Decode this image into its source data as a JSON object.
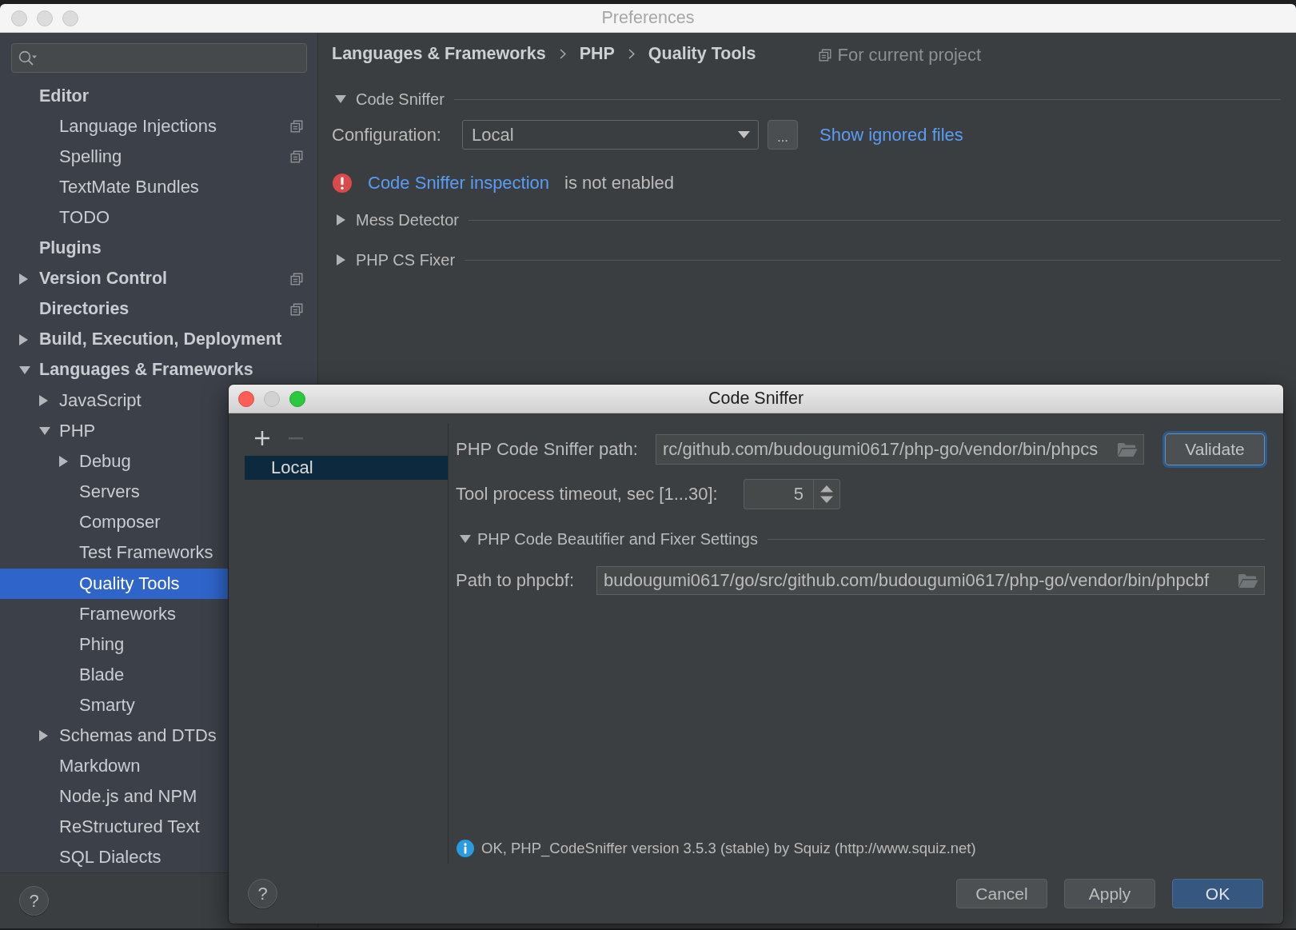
{
  "preferences_window": {
    "title": "Preferences",
    "active": false
  },
  "sidebar": {
    "items": [
      {
        "label": "Editor",
        "selected": false,
        "project_scope": false,
        "children": [
          {
            "label": "Language Injections",
            "selected": false,
            "project_scope": true
          },
          {
            "label": "Spelling",
            "selected": false,
            "project_scope": true
          },
          {
            "label": "TextMate Bundles",
            "selected": false,
            "project_scope": false
          },
          {
            "label": "TODO",
            "selected": false,
            "project_scope": false
          }
        ]
      },
      {
        "label": "Plugins",
        "selected": false,
        "project_scope": false
      },
      {
        "label": "Version Control",
        "expanded": false,
        "selected": false,
        "project_scope": true
      },
      {
        "label": "Directories",
        "selected": false,
        "project_scope": true
      },
      {
        "label": "Build, Execution, Deployment",
        "expanded": false,
        "selected": false,
        "project_scope": false
      },
      {
        "label": "Languages & Frameworks",
        "expanded": true,
        "selected": false,
        "project_scope": false,
        "children": [
          {
            "label": "JavaScript",
            "expanded": false,
            "selected": false
          },
          {
            "label": "PHP",
            "expanded": true,
            "selected": false,
            "children": [
              {
                "label": "Debug",
                "expanded": false,
                "selected": false
              },
              {
                "label": "Servers",
                "selected": false
              },
              {
                "label": "Composer",
                "selected": false
              },
              {
                "label": "Test Frameworks",
                "selected": false
              },
              {
                "label": "Quality Tools",
                "selected": true
              },
              {
                "label": "Frameworks",
                "selected": false
              },
              {
                "label": "Phing",
                "selected": false
              },
              {
                "label": "Blade",
                "selected": false
              },
              {
                "label": "Smarty",
                "selected": false
              }
            ]
          },
          {
            "label": "Schemas and DTDs",
            "expanded": false,
            "selected": false
          },
          {
            "label": "Markdown",
            "selected": false
          },
          {
            "label": "Node.js and NPM",
            "selected": false
          },
          {
            "label": "ReStructured Text",
            "selected": false
          },
          {
            "label": "SQL Dialects",
            "selected": false
          }
        ]
      }
    ],
    "help_button": "?"
  },
  "main": {
    "breadcrumb": [
      "Languages & Frameworks",
      "PHP",
      "Quality Tools"
    ],
    "scope_note": "For current project",
    "sections": [
      {
        "kind": "code_sniffer",
        "title": "Code Sniffer",
        "expanded": true,
        "configuration": {
          "label": "Configuration:",
          "value": "Local",
          "more_button": "...",
          "link": "Show ignored files"
        },
        "warning": {
          "link": "Code Sniffer inspection",
          "text": "is not enabled"
        }
      },
      {
        "kind": "plain",
        "title": "Mess Detector",
        "expanded": false
      },
      {
        "kind": "plain",
        "title": "PHP CS Fixer",
        "expanded": false
      }
    ]
  },
  "dialog": {
    "title": "Code Sniffer",
    "active": true,
    "minimize_disabled": true,
    "toolbar": [
      {
        "kind": "add",
        "disabled": false
      },
      {
        "kind": "remove",
        "disabled": true
      }
    ],
    "list": [
      {
        "label": "Local",
        "selected": true
      }
    ],
    "sniffer_path": {
      "label": "PHP Code Sniffer path:",
      "value": "rc/github.com/budougumi0617/php-go/vendor/bin/phpcs"
    },
    "validate_button": {
      "label": "Validate",
      "focused": true
    },
    "timeout": {
      "label": "Tool process timeout, sec [1...30]:",
      "value": "5"
    },
    "beautifier": {
      "title": "PHP Code Beautifier and Fixer Settings",
      "expanded": true,
      "label": "Path to phpcbf:",
      "value": "budougumi0617/go/src/github.com/budougumi0617/php-go/vendor/bin/phpcbf"
    },
    "status": {
      "kind": "info",
      "text": "OK, PHP_CodeSniffer version 3.5.3 (stable) by Squiz (http://www.squiz.net)"
    },
    "help_button": "?",
    "buttons": [
      {
        "label": "Cancel",
        "default": false
      },
      {
        "label": "Apply",
        "default": false
      },
      {
        "label": "OK",
        "default": true
      }
    ]
  }
}
